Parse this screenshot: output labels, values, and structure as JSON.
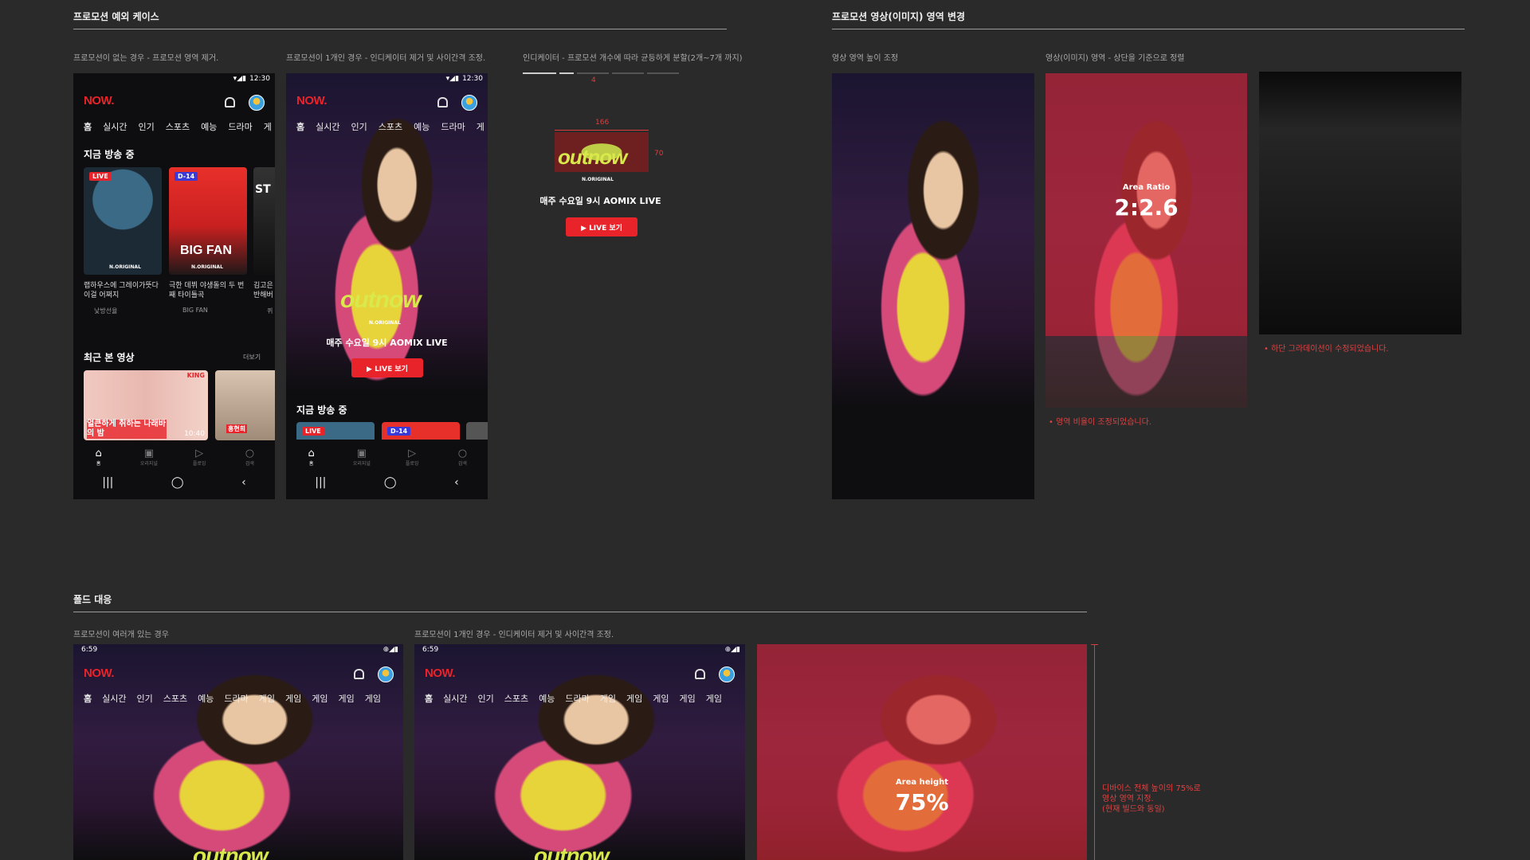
{
  "sections": {
    "exception": {
      "title": "프로모션 예외 케이스"
    },
    "area": {
      "title": "프로모션 영상(이미지) 영역 변경"
    },
    "fold": {
      "title": "폴드 대응"
    }
  },
  "captions": {
    "no_promo": "프로모션이 없는 경우 - 프로모션 영역 제거.",
    "one_promo": "프로모션이 1개인 경우 - 인디케이터 제거 및 사이간격 조정.",
    "indicator": "인디케이터 - 프로모션 개수에 따라 균등하게 분할(2개~7개 까지)",
    "height_adj": "영상 영역 높이 조정",
    "align_top": "영상(이미지) 영역 - 상단을 기준으로 정렬",
    "fold_multi": "프로모션이 여러개 있는 경우",
    "fold_one": "프로모션이 1개인 경우 - 인디케이터 제거 및 사이간격 조정."
  },
  "indicator_spec": {
    "gap": "4",
    "width": "166",
    "height": "70"
  },
  "app": {
    "logo": "NOW.",
    "time": "12:30",
    "fold_time": "6:59",
    "tabs": [
      "홈",
      "실시간",
      "인기",
      "스포츠",
      "예능",
      "드라마",
      "게"
    ],
    "fold_tabs": [
      "홈",
      "실시간",
      "인기",
      "스포츠",
      "예능",
      "드라마",
      "게임",
      "게임",
      "게임",
      "게임",
      "게임"
    ],
    "live_now": "지금 방송 중",
    "recent": "최근 본 영상",
    "more": "더보기",
    "cards": [
      {
        "badge": "LIVE",
        "title": "랩하우스에 그레이가뜻다 이걸 어쩌지",
        "channel": "낯방선율",
        "brand": "N.ORIGINAL"
      },
      {
        "badge": "D-14",
        "title": "극한 데뷔 야생돌의 두 번째 타이틀곡",
        "channel": "BIG FAN",
        "brand": "N.ORIGINAL",
        "art": "BIG FAN"
      },
      {
        "badge": "",
        "title": "김고은 반해버",
        "channel": "퀴",
        "art": "ST"
      }
    ],
    "recent_item": {
      "overlay": "얼큰하게 취하는 나래바의 밤",
      "time": "10:40",
      "tag": "KING"
    },
    "recent_item2": {
      "tag": "홍현희"
    },
    "hero": {
      "brand": "N.ORIGINAL",
      "art": "outnow",
      "title": "매주 수요일 9시 AOMIX LIVE",
      "button": "▶ LIVE 보기"
    },
    "bottom_nav": [
      "홈",
      "오리지널",
      "플로잉",
      "검색"
    ],
    "badges": {
      "live": "LIVE",
      "d14": "D-14"
    }
  },
  "ratio": {
    "label": "Area Ratio",
    "value": "2:2.6"
  },
  "height": {
    "label": "Area height",
    "value": "75%"
  },
  "notes": {
    "ratio_adjusted": "영역 비율이 조정되었습니다.",
    "gradient_fixed": "하단 그라데이션이 수정되었습니다.",
    "fold_height": [
      "디바이스 전체 높이의 75%로",
      "영상 영역 지정.",
      "(현재 빌드와 동일)"
    ]
  }
}
